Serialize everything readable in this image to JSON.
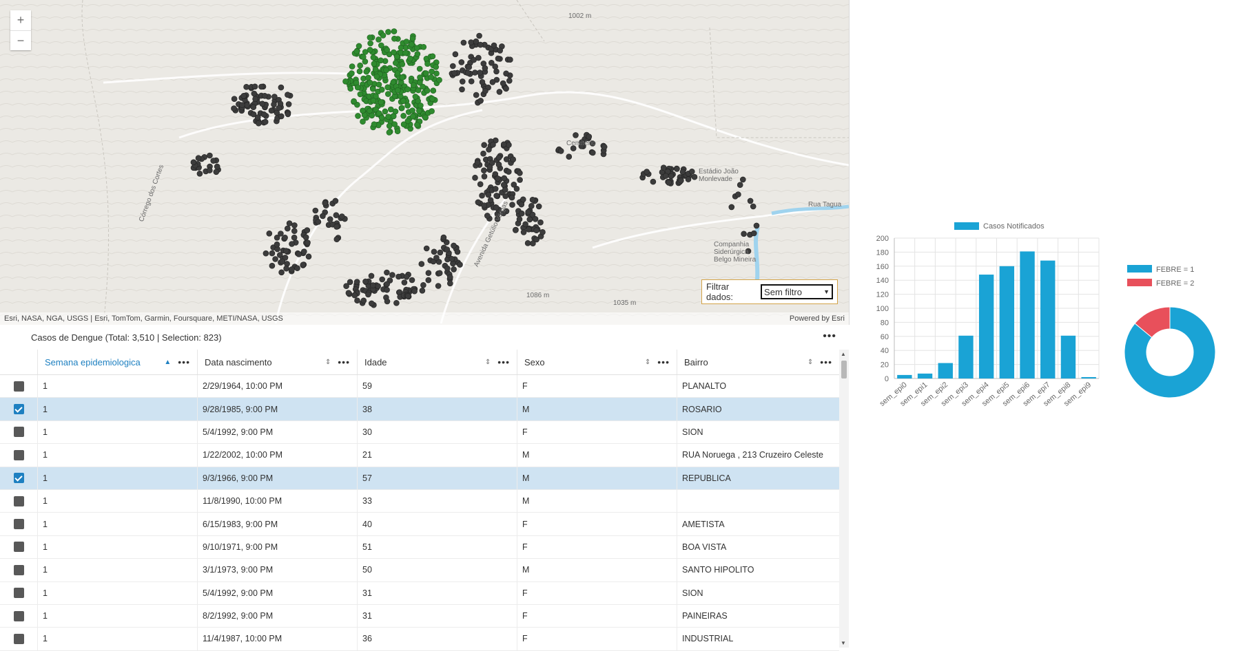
{
  "map": {
    "zoom_in": "+",
    "zoom_out": "−",
    "labels": [
      "1002 m",
      "Cemitério",
      "Estádio João Monlevade",
      "Rua Tagua",
      "Companhia Siderúrgica Belgo Mineira",
      "1086 m",
      "1035 m",
      "Córrego dos Cortes",
      "Avenida Getúlio Vargas"
    ],
    "attribution": "Esri, NASA, NGA, USGS | Esri, TomTom, Garmin, Foursquare, METI/NASA, USGS",
    "powered_by": "Powered by Esri",
    "filter_label": "Filtrar dados:",
    "filter_value": "Sem filtro",
    "colors": {
      "case_dot": "#3c3c3c",
      "selected_dot": "#2f8b2f"
    }
  },
  "table": {
    "title": "Casos de Dengue (Total: 3,510 | Selection: 823)",
    "menu_icon": "more-icon",
    "columns": [
      "Semana epidemiologica",
      "Data nascimento",
      "Idade",
      "Sexo",
      "Bairro"
    ],
    "sorted_column": "Semana epidemiologica",
    "rows": [
      {
        "selected": false,
        "semana": "1",
        "data": "2/29/1964, 10:00 PM",
        "idade": "59",
        "sexo": "F",
        "bairro": "PLANALTO"
      },
      {
        "selected": true,
        "semana": "1",
        "data": "9/28/1985, 9:00 PM",
        "idade": "38",
        "sexo": "M",
        "bairro": "ROSARIO"
      },
      {
        "selected": false,
        "semana": "1",
        "data": "5/4/1992, 9:00 PM",
        "idade": "30",
        "sexo": "F",
        "bairro": "SION"
      },
      {
        "selected": false,
        "semana": "1",
        "data": "1/22/2002, 10:00 PM",
        "idade": "21",
        "sexo": "M",
        "bairro": "RUA Noruega , 213 Cruzeiro Celeste"
      },
      {
        "selected": true,
        "semana": "1",
        "data": "9/3/1966, 9:00 PM",
        "idade": "57",
        "sexo": "M",
        "bairro": "REPUBLICA"
      },
      {
        "selected": false,
        "semana": "1",
        "data": "11/8/1990, 10:00 PM",
        "idade": "33",
        "sexo": "M",
        "bairro": ""
      },
      {
        "selected": false,
        "semana": "1",
        "data": "6/15/1983, 9:00 PM",
        "idade": "40",
        "sexo": "F",
        "bairro": "AMETISTA"
      },
      {
        "selected": false,
        "semana": "1",
        "data": "9/10/1971, 9:00 PM",
        "idade": "51",
        "sexo": "F",
        "bairro": "BOA VISTA"
      },
      {
        "selected": false,
        "semana": "1",
        "data": "3/1/1973, 9:00 PM",
        "idade": "50",
        "sexo": "M",
        "bairro": "SANTO HIPOLITO"
      },
      {
        "selected": false,
        "semana": "1",
        "data": "5/4/1992, 9:00 PM",
        "idade": "31",
        "sexo": "F",
        "bairro": "SION"
      },
      {
        "selected": false,
        "semana": "1",
        "data": "8/2/1992, 9:00 PM",
        "idade": "31",
        "sexo": "F",
        "bairro": "PAINEIRAS"
      },
      {
        "selected": false,
        "semana": "1",
        "data": "11/4/1987, 10:00 PM",
        "idade": "36",
        "sexo": "F",
        "bairro": "INDUSTRIAL"
      }
    ]
  },
  "chart_data": [
    {
      "type": "bar",
      "legend": "Casos Notificados",
      "categories": [
        "sem_epi0",
        "sem_epi1",
        "sem_epi2",
        "sem_epi3",
        "sem_epi4",
        "sem_epi5",
        "sem_epi6",
        "sem_epi7",
        "sem_epi8",
        "sem_epi9"
      ],
      "values": [
        5,
        7,
        22,
        61,
        148,
        160,
        181,
        168,
        61,
        2
      ],
      "ylim": [
        0,
        200
      ],
      "yticks": [
        0,
        20,
        40,
        60,
        80,
        100,
        120,
        140,
        160,
        180,
        200
      ],
      "color": "#1aa3d5",
      "grid": true
    },
    {
      "type": "pie",
      "donut": true,
      "labels": [
        "FEBRE = 1",
        "FEBRE = 2"
      ],
      "values": [
        86,
        14
      ],
      "colors": [
        "#1aa3d5",
        "#e8505b"
      ]
    }
  ]
}
